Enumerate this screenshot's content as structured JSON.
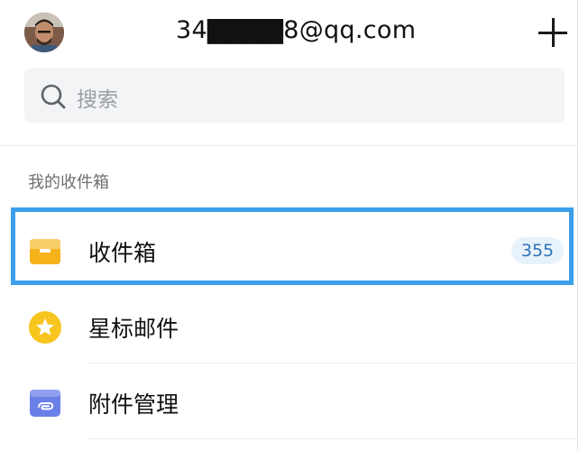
{
  "header": {
    "account_email": "34▇▇▇▇8@qq.com",
    "avatar_icon": "user-avatar-photo",
    "add_icon": "plus-icon"
  },
  "search": {
    "placeholder": "搜索",
    "icon": "search-icon"
  },
  "section": {
    "title": "我的收件箱"
  },
  "folders": [
    {
      "label": "收件箱",
      "icon": "inbox-tray-icon",
      "count": "355",
      "selected": true,
      "color": "#f5b21c"
    },
    {
      "label": "星标邮件",
      "icon": "star-icon",
      "color": "#f7c51d"
    },
    {
      "label": "附件管理",
      "icon": "attachment-icon",
      "color": "#6a7fe8"
    }
  ],
  "colors": {
    "selection_border": "#3b9fe9",
    "badge_bg": "#e8f2fb",
    "badge_text": "#2f72b8"
  }
}
